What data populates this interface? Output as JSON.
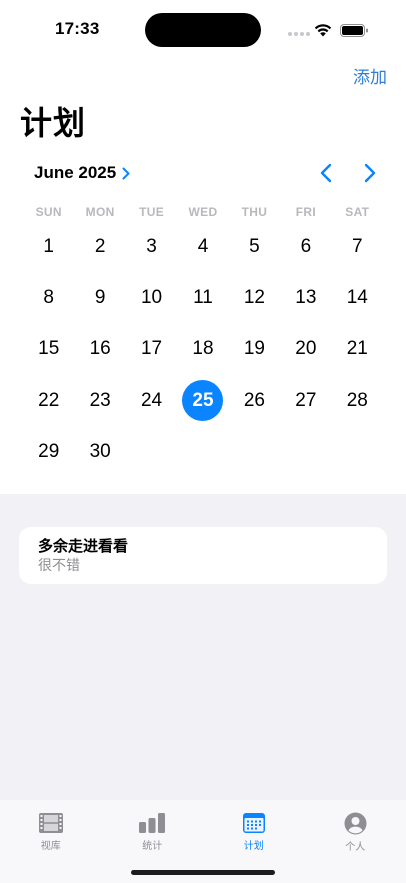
{
  "status_bar": {
    "time": "17:33"
  },
  "header": {
    "add_label": "添加",
    "title": "计划"
  },
  "calendar": {
    "month_label": "June 2025",
    "weekdays": [
      "SUN",
      "MON",
      "TUE",
      "WED",
      "THU",
      "FRI",
      "SAT"
    ],
    "days": [
      "1",
      "2",
      "3",
      "4",
      "5",
      "6",
      "7",
      "8",
      "9",
      "10",
      "11",
      "12",
      "13",
      "14",
      "15",
      "16",
      "17",
      "18",
      "19",
      "20",
      "21",
      "22",
      "23",
      "24",
      "25",
      "26",
      "27",
      "28",
      "29",
      "30"
    ],
    "selected_day": "25",
    "accent_color": "#0a84ff"
  },
  "plans": [
    {
      "title": "多余走进看看",
      "subtitle": "很不错"
    }
  ],
  "tab_bar": {
    "tabs": [
      {
        "label": "视库",
        "icon": "film-icon"
      },
      {
        "label": "统计",
        "icon": "bar-chart-icon"
      },
      {
        "label": "计划",
        "icon": "calendar-icon",
        "active": true
      },
      {
        "label": "个人",
        "icon": "person-icon"
      }
    ]
  }
}
